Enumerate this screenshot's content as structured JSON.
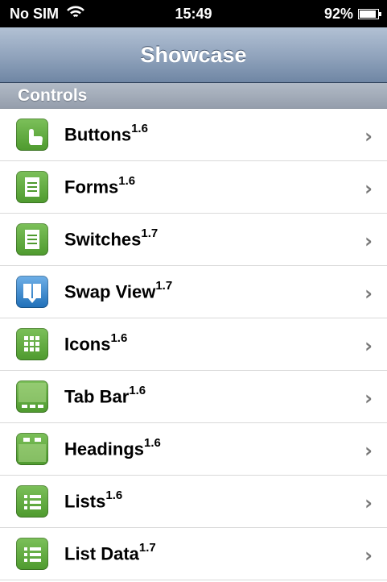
{
  "status_bar": {
    "carrier": "No SIM",
    "time": "15:49",
    "battery": "92%",
    "battery_level": 0.92
  },
  "nav": {
    "title": "Showcase"
  },
  "section": {
    "title": "Controls"
  },
  "items": [
    {
      "label": "Buttons",
      "version": "1.6",
      "icon": "hand-pointer-icon",
      "color": "#4e9a2e"
    },
    {
      "label": "Forms",
      "version": "1.6",
      "icon": "document-icon",
      "color": "#4e9a2e"
    },
    {
      "label": "Switches",
      "version": "1.7",
      "icon": "document-icon",
      "color": "#4e9a2e"
    },
    {
      "label": "Swap View",
      "version": "1.7",
      "icon": "swap-view-icon",
      "color": "#1f6fb8"
    },
    {
      "label": "Icons",
      "version": "1.6",
      "icon": "grid-icon",
      "color": "#4e9a2e"
    },
    {
      "label": "Tab Bar",
      "version": "1.6",
      "icon": "tab-bar-icon",
      "color": "#4e9a2e"
    },
    {
      "label": "Headings",
      "version": "1.6",
      "icon": "heading-bar-icon",
      "color": "#4e9a2e"
    },
    {
      "label": "Lists",
      "version": "1.6",
      "icon": "list-icon",
      "color": "#4e9a2e"
    },
    {
      "label": "List Data",
      "version": "1.7",
      "icon": "list-icon",
      "color": "#4e9a2e"
    }
  ]
}
